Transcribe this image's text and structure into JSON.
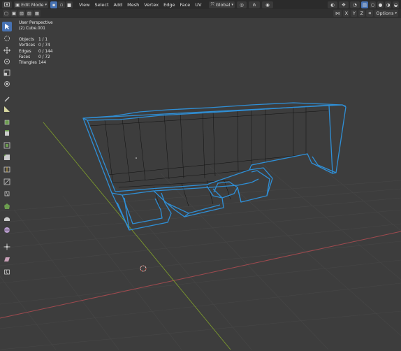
{
  "header": {
    "mode": "Edit Mode",
    "menus": [
      "View",
      "Select",
      "Add",
      "Mesh",
      "Vertex",
      "Edge",
      "Face",
      "UV"
    ],
    "transform_orientation": "Global"
  },
  "header2": {
    "axes": [
      "X",
      "Y",
      "Z"
    ],
    "options_label": "Options"
  },
  "overlay_info": {
    "title": "User Perspective",
    "object_name": "(2) Cube.001",
    "rows": [
      {
        "label": "Objects",
        "value": "1 / 1"
      },
      {
        "label": "Vertices",
        "value": "0 / 74"
      },
      {
        "label": "Edges",
        "value": "0 / 144"
      },
      {
        "label": "Faces",
        "value": "0 / 72"
      },
      {
        "label": "Triangles",
        "value": "144"
      }
    ]
  },
  "tools": [
    {
      "name": "select-box-tool",
      "icon": "select-box-icon",
      "active": true
    },
    {
      "name": "cursor-tool",
      "icon": "cursor-icon"
    },
    {
      "name": "move-tool",
      "icon": "move-icon"
    },
    {
      "name": "rotate-tool",
      "icon": "rotate-icon"
    },
    {
      "name": "scale-tool",
      "icon": "scale-icon"
    },
    {
      "name": "transform-tool",
      "icon": "transform-icon"
    },
    {
      "name": "annotate-tool",
      "icon": "annotate-icon"
    },
    {
      "name": "measure-tool",
      "icon": "measure-icon"
    },
    {
      "name": "add-cube-tool",
      "icon": "add-cube-icon"
    },
    {
      "name": "extrude-tool",
      "icon": "extrude-icon"
    },
    {
      "name": "inset-tool",
      "icon": "inset-icon"
    },
    {
      "name": "bevel-tool",
      "icon": "bevel-icon"
    },
    {
      "name": "loop-cut-tool",
      "icon": "loop-cut-icon"
    },
    {
      "name": "knife-tool",
      "icon": "knife-icon"
    },
    {
      "name": "poly-build-tool",
      "icon": "poly-build-icon"
    },
    {
      "name": "spin-tool",
      "icon": "spin-icon"
    },
    {
      "name": "smooth-tool",
      "icon": "smooth-icon"
    },
    {
      "name": "edge-slide-tool",
      "icon": "edge-slide-icon"
    },
    {
      "name": "shrink-fatten-tool",
      "icon": "shrink-fatten-icon"
    },
    {
      "name": "shear-tool",
      "icon": "shear-icon"
    },
    {
      "name": "rip-tool",
      "icon": "rip-icon"
    }
  ],
  "colors": {
    "viewport_bg": "#3d3d3d",
    "grid": "#4a4a4a",
    "x_axis": "#a04a4f",
    "y_axis": "#7c9a2d",
    "wire_outer": "#2f8fd6",
    "wire_inner": "#111111",
    "active_button": "#4772b3"
  }
}
